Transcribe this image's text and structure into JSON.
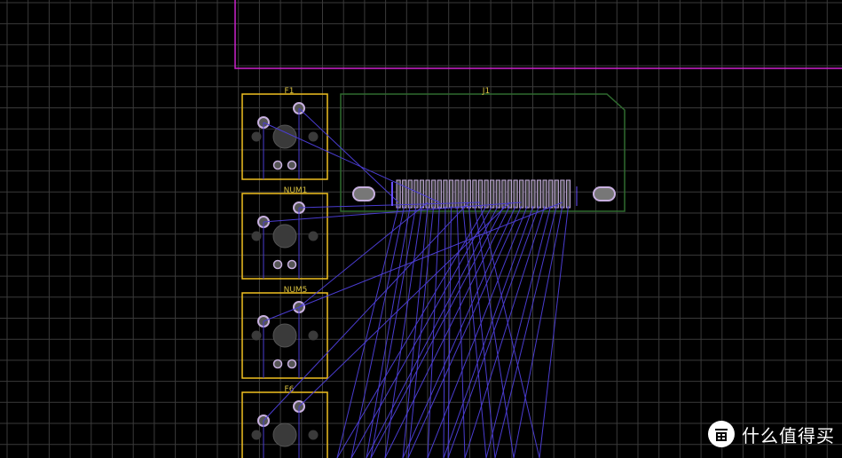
{
  "board": {
    "colors": {
      "background": "#000000",
      "grid": "#4a4a4a",
      "outline": "#cc22cc",
      "footprint": "#f0c020",
      "connector_body": "#2f6a2f",
      "ratsnest": "#4a3cd0",
      "pad": "#b9a0d8",
      "drill": "#3a3a3a"
    },
    "components": [
      {
        "ref": "F1",
        "type": "switch"
      },
      {
        "ref": "NUM1",
        "type": "switch"
      },
      {
        "ref": "NUM5",
        "type": "switch"
      },
      {
        "ref": "F6",
        "type": "switch"
      },
      {
        "ref": "J1",
        "type": "connector",
        "pin_count": 30
      }
    ]
  },
  "watermark": {
    "logo_char": "值",
    "text": "什么值得买",
    "logo_icon": "smzdm-logo-icon"
  }
}
